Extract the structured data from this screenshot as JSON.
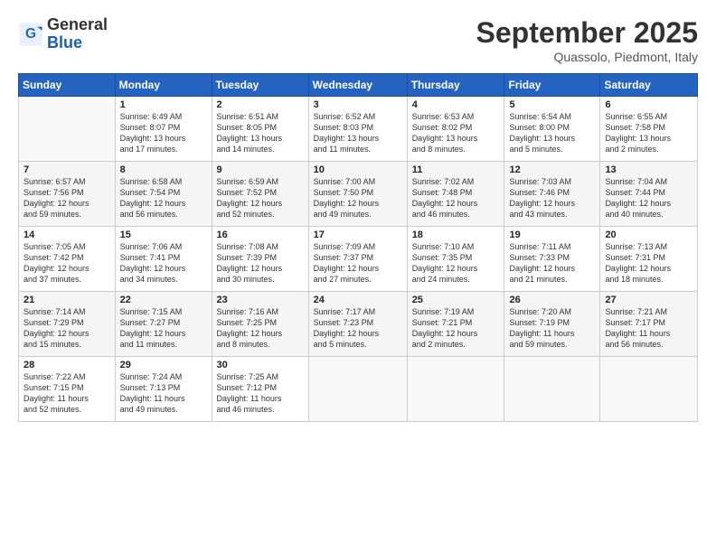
{
  "header": {
    "logo_line1": "General",
    "logo_line2": "Blue",
    "month": "September 2025",
    "location": "Quassolo, Piedmont, Italy"
  },
  "weekdays": [
    "Sunday",
    "Monday",
    "Tuesday",
    "Wednesday",
    "Thursday",
    "Friday",
    "Saturday"
  ],
  "weeks": [
    [
      {
        "day": "",
        "info": ""
      },
      {
        "day": "1",
        "info": "Sunrise: 6:49 AM\nSunset: 8:07 PM\nDaylight: 13 hours\nand 17 minutes."
      },
      {
        "day": "2",
        "info": "Sunrise: 6:51 AM\nSunset: 8:05 PM\nDaylight: 13 hours\nand 14 minutes."
      },
      {
        "day": "3",
        "info": "Sunrise: 6:52 AM\nSunset: 8:03 PM\nDaylight: 13 hours\nand 11 minutes."
      },
      {
        "day": "4",
        "info": "Sunrise: 6:53 AM\nSunset: 8:02 PM\nDaylight: 13 hours\nand 8 minutes."
      },
      {
        "day": "5",
        "info": "Sunrise: 6:54 AM\nSunset: 8:00 PM\nDaylight: 13 hours\nand 5 minutes."
      },
      {
        "day": "6",
        "info": "Sunrise: 6:55 AM\nSunset: 7:58 PM\nDaylight: 13 hours\nand 2 minutes."
      }
    ],
    [
      {
        "day": "7",
        "info": "Sunrise: 6:57 AM\nSunset: 7:56 PM\nDaylight: 12 hours\nand 59 minutes."
      },
      {
        "day": "8",
        "info": "Sunrise: 6:58 AM\nSunset: 7:54 PM\nDaylight: 12 hours\nand 56 minutes."
      },
      {
        "day": "9",
        "info": "Sunrise: 6:59 AM\nSunset: 7:52 PM\nDaylight: 12 hours\nand 52 minutes."
      },
      {
        "day": "10",
        "info": "Sunrise: 7:00 AM\nSunset: 7:50 PM\nDaylight: 12 hours\nand 49 minutes."
      },
      {
        "day": "11",
        "info": "Sunrise: 7:02 AM\nSunset: 7:48 PM\nDaylight: 12 hours\nand 46 minutes."
      },
      {
        "day": "12",
        "info": "Sunrise: 7:03 AM\nSunset: 7:46 PM\nDaylight: 12 hours\nand 43 minutes."
      },
      {
        "day": "13",
        "info": "Sunrise: 7:04 AM\nSunset: 7:44 PM\nDaylight: 12 hours\nand 40 minutes."
      }
    ],
    [
      {
        "day": "14",
        "info": "Sunrise: 7:05 AM\nSunset: 7:42 PM\nDaylight: 12 hours\nand 37 minutes."
      },
      {
        "day": "15",
        "info": "Sunrise: 7:06 AM\nSunset: 7:41 PM\nDaylight: 12 hours\nand 34 minutes."
      },
      {
        "day": "16",
        "info": "Sunrise: 7:08 AM\nSunset: 7:39 PM\nDaylight: 12 hours\nand 30 minutes."
      },
      {
        "day": "17",
        "info": "Sunrise: 7:09 AM\nSunset: 7:37 PM\nDaylight: 12 hours\nand 27 minutes."
      },
      {
        "day": "18",
        "info": "Sunrise: 7:10 AM\nSunset: 7:35 PM\nDaylight: 12 hours\nand 24 minutes."
      },
      {
        "day": "19",
        "info": "Sunrise: 7:11 AM\nSunset: 7:33 PM\nDaylight: 12 hours\nand 21 minutes."
      },
      {
        "day": "20",
        "info": "Sunrise: 7:13 AM\nSunset: 7:31 PM\nDaylight: 12 hours\nand 18 minutes."
      }
    ],
    [
      {
        "day": "21",
        "info": "Sunrise: 7:14 AM\nSunset: 7:29 PM\nDaylight: 12 hours\nand 15 minutes."
      },
      {
        "day": "22",
        "info": "Sunrise: 7:15 AM\nSunset: 7:27 PM\nDaylight: 12 hours\nand 11 minutes."
      },
      {
        "day": "23",
        "info": "Sunrise: 7:16 AM\nSunset: 7:25 PM\nDaylight: 12 hours\nand 8 minutes."
      },
      {
        "day": "24",
        "info": "Sunrise: 7:17 AM\nSunset: 7:23 PM\nDaylight: 12 hours\nand 5 minutes."
      },
      {
        "day": "25",
        "info": "Sunrise: 7:19 AM\nSunset: 7:21 PM\nDaylight: 12 hours\nand 2 minutes."
      },
      {
        "day": "26",
        "info": "Sunrise: 7:20 AM\nSunset: 7:19 PM\nDaylight: 11 hours\nand 59 minutes."
      },
      {
        "day": "27",
        "info": "Sunrise: 7:21 AM\nSunset: 7:17 PM\nDaylight: 11 hours\nand 56 minutes."
      }
    ],
    [
      {
        "day": "28",
        "info": "Sunrise: 7:22 AM\nSunset: 7:15 PM\nDaylight: 11 hours\nand 52 minutes."
      },
      {
        "day": "29",
        "info": "Sunrise: 7:24 AM\nSunset: 7:13 PM\nDaylight: 11 hours\nand 49 minutes."
      },
      {
        "day": "30",
        "info": "Sunrise: 7:25 AM\nSunset: 7:12 PM\nDaylight: 11 hours\nand 46 minutes."
      },
      {
        "day": "",
        "info": ""
      },
      {
        "day": "",
        "info": ""
      },
      {
        "day": "",
        "info": ""
      },
      {
        "day": "",
        "info": ""
      }
    ]
  ]
}
